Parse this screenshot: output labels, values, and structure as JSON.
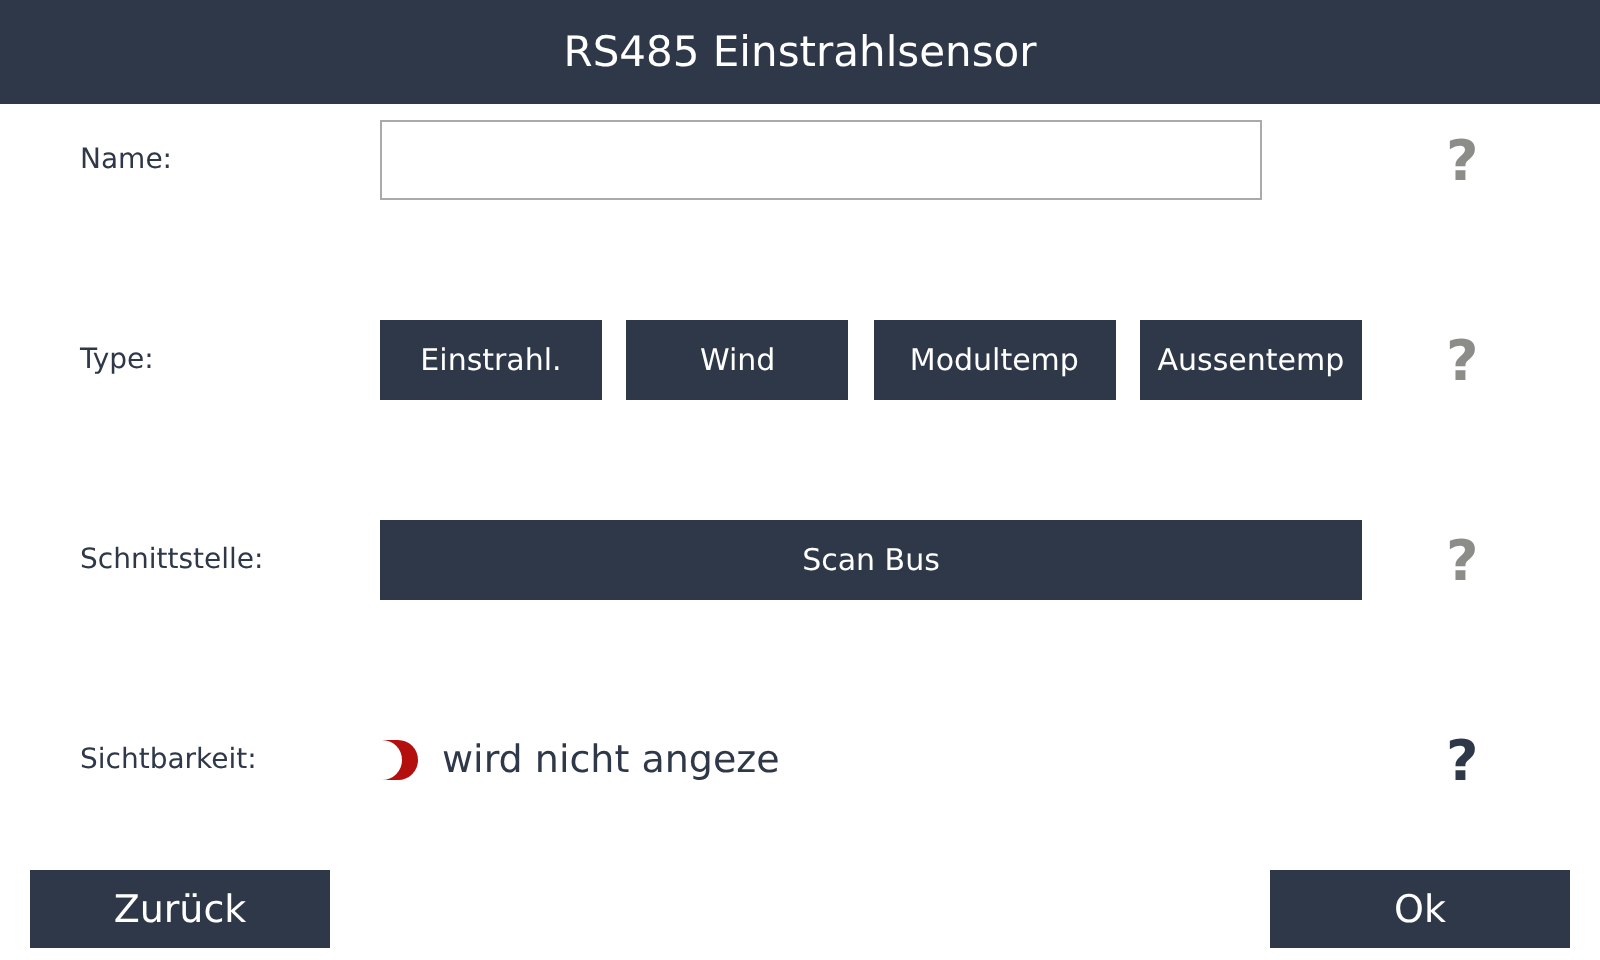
{
  "header": {
    "title": "RS485 Einstrahlsensor"
  },
  "rows": [
    {
      "kind": "input",
      "label": "Name:",
      "value": "",
      "help": "?",
      "help_active": false
    },
    {
      "kind": "choices",
      "label": "Type:",
      "options": [
        {
          "label": "Einstrahl."
        },
        {
          "label": "Wind"
        },
        {
          "label": "Modultemp"
        },
        {
          "label": "Aussentemp"
        }
      ],
      "help": "?",
      "help_active": false
    },
    {
      "kind": "button",
      "label": "Schnittstelle:",
      "button": "Scan Bus",
      "help": "?",
      "help_active": false
    },
    {
      "kind": "toggle",
      "label": "Sichtbarkeit:",
      "on": false,
      "text": "wird nicht angeze",
      "help": "?",
      "help_active": true
    }
  ],
  "footer": {
    "back": "Zurück",
    "ok": "Ok"
  }
}
